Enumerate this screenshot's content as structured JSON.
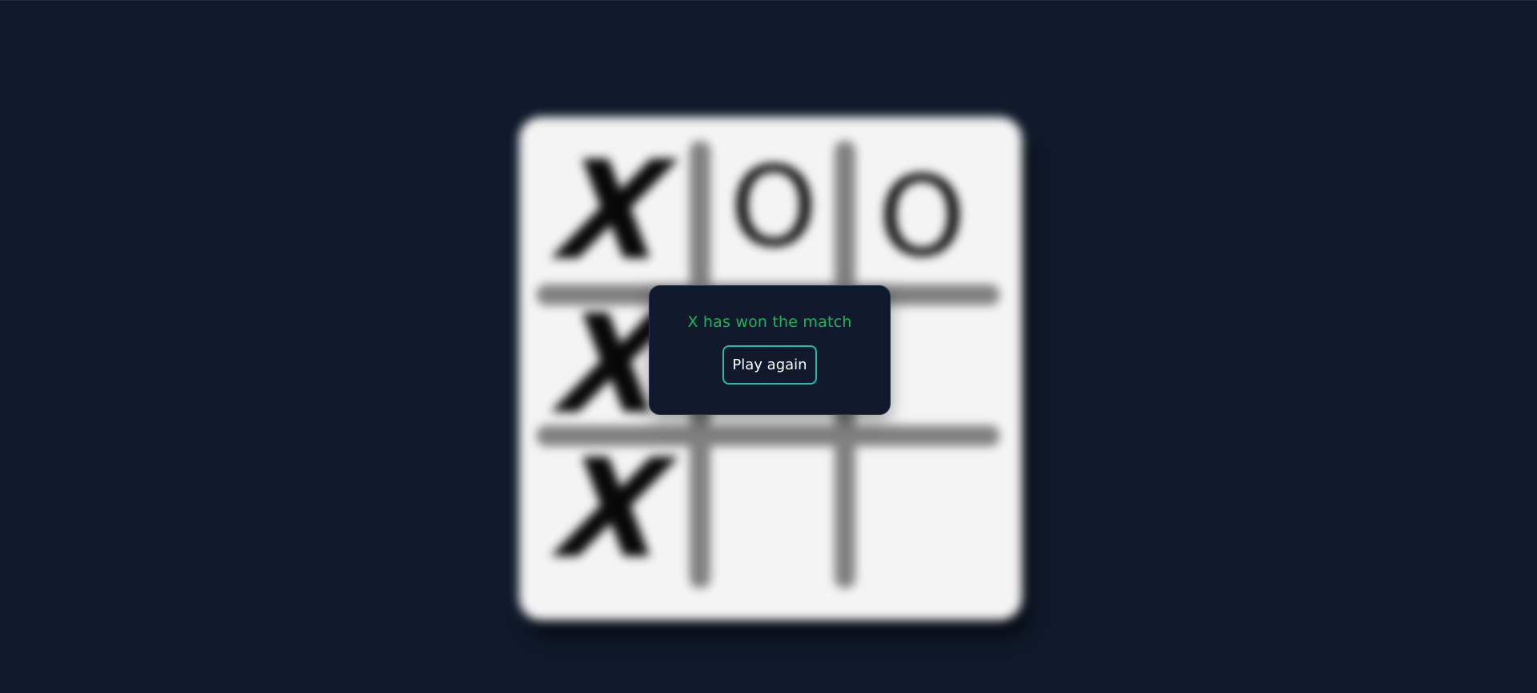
{
  "game": {
    "board": [
      [
        "X",
        "O",
        "O"
      ],
      [
        "X",
        "",
        ""
      ],
      [
        "X",
        "",
        ""
      ]
    ]
  },
  "result": {
    "message": "X has won the match",
    "play_again_label": "Play again"
  },
  "colors": {
    "background": "#111a2c",
    "board": "#f4f4f4",
    "grid_lines": "#808080",
    "marks": "#080808",
    "win_text": "#22b35a",
    "button_border": "#2cb7ad",
    "button_text": "#ffffff"
  }
}
